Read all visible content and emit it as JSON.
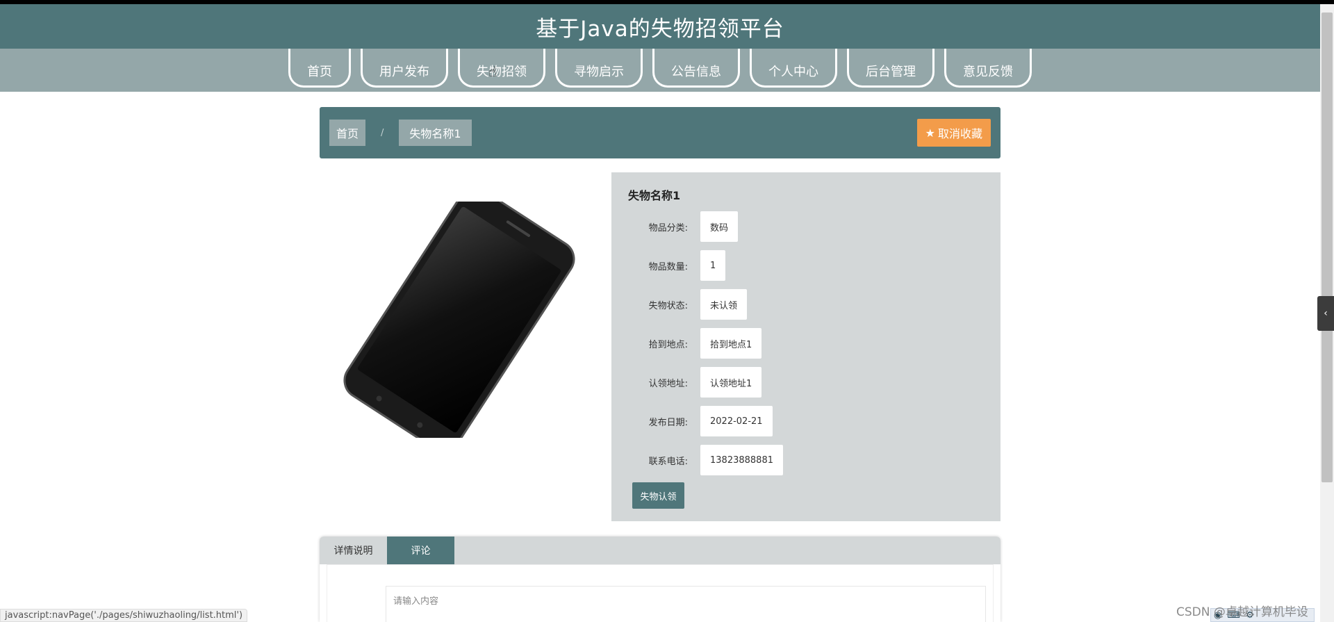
{
  "header": {
    "title": "基于Java的失物招领平台"
  },
  "nav": {
    "items": [
      {
        "label": "首页"
      },
      {
        "label": "用户发布"
      },
      {
        "label": "失物招领"
      },
      {
        "label": "寻物启示"
      },
      {
        "label": "公告信息"
      },
      {
        "label": "个人中心"
      },
      {
        "label": "后台管理"
      },
      {
        "label": "意见反馈"
      }
    ]
  },
  "breadcrumb": {
    "home": "首页",
    "separator": "/",
    "current": "失物名称1"
  },
  "favorite": {
    "label": "取消收藏",
    "icon": "star-icon"
  },
  "detail": {
    "title": "失物名称1",
    "fields": [
      {
        "label": "物品分类:",
        "value": "数码"
      },
      {
        "label": "物品数量:",
        "value": "1"
      },
      {
        "label": "失物状态:",
        "value": "未认领"
      },
      {
        "label": "拾到地点:",
        "value": "拾到地点1"
      },
      {
        "label": "认领地址:",
        "value": "认领地址1"
      },
      {
        "label": "发布日期:",
        "value": "2022-02-21"
      },
      {
        "label": "联系电话:",
        "value": "13823888881"
      }
    ],
    "claim_button": "失物认领"
  },
  "tabs": {
    "items": [
      {
        "label": "详情说明"
      },
      {
        "label": "评论"
      }
    ],
    "active": "评论"
  },
  "comment": {
    "placeholder": "请输入内容"
  },
  "status_bar": {
    "url": "javascript:navPage('./pages/shiwuzhaoling/list.html')"
  },
  "watermark": "CSDN @卓越计算机毕设",
  "colors": {
    "primary": "#4f767a",
    "nav_bg": "#94a7a9",
    "accent": "#f39c4a",
    "panel_bg": "#d3d7d8"
  }
}
